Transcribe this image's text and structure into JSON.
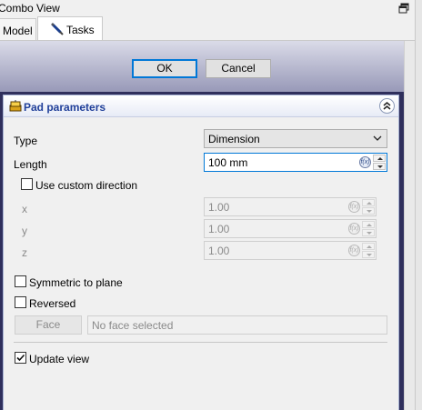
{
  "window": {
    "title": "Combo View"
  },
  "tabs": [
    {
      "label": "Model",
      "active": false
    },
    {
      "label": "Tasks",
      "active": true
    }
  ],
  "dialog": {
    "ok_label": "OK",
    "cancel_label": "Cancel"
  },
  "panel": {
    "title": "Pad parameters",
    "type": {
      "label": "Type",
      "value": "Dimension"
    },
    "length": {
      "label": "Length",
      "value": "100 mm"
    },
    "custom_direction": {
      "label": "Use custom direction",
      "checked": false
    },
    "direction": {
      "x": {
        "label": "x",
        "value": "1.00"
      },
      "y": {
        "label": "y",
        "value": "1.00"
      },
      "z": {
        "label": "z",
        "value": "1.00"
      }
    },
    "symmetric": {
      "label": "Symmetric to plane",
      "checked": false
    },
    "reversed": {
      "label": "Reversed",
      "checked": false
    },
    "face": {
      "button_label": "Face",
      "placeholder": "No face selected"
    },
    "update_view": {
      "label": "Update view",
      "checked": true
    }
  },
  "colors": {
    "header_text": "#21409a",
    "focus_border": "#0078d7",
    "task_bg_dark": "#2f2f5c"
  },
  "icons": {
    "float": "float-window-icon",
    "tasks_tab": "pen-icon",
    "panel": "pad-icon",
    "collapse": "chevron-up-double-icon",
    "expression": "fx-expression-icon"
  }
}
